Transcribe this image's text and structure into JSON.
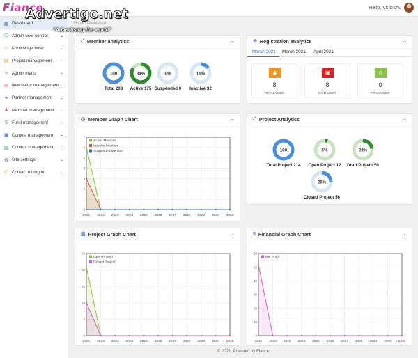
{
  "brand": {
    "logo": "Fiance",
    "watermark": "Advertigo.net",
    "watermark_tagline": "\"Advertising  the world\""
  },
  "header": {
    "collapse_icon": "chevron-left-icon",
    "user_greeting": "Hello, Vk bishu"
  },
  "breadcrumb": {
    "home": "Home",
    "sep": "/",
    "current": "Dashboard"
  },
  "sidebar": {
    "items": [
      {
        "label": "Dashboard",
        "icon": "grid-icon",
        "glyph": "▦",
        "color": "#4a7cc2",
        "expandable": false,
        "active": true
      },
      {
        "label": "Admin user control",
        "icon": "power-icon",
        "glyph": "⏻",
        "color": "#3aa76d",
        "expandable": true
      },
      {
        "label": "Knowledge base",
        "icon": "book-icon",
        "glyph": "▭",
        "color": "#e0a030",
        "expandable": true
      },
      {
        "label": "Project management",
        "icon": "document-icon",
        "glyph": "▤",
        "color": "#e0a030",
        "expandable": true
      },
      {
        "label": "Admin menu",
        "icon": "menu-icon",
        "glyph": "≡",
        "color": "#4a7cc2",
        "expandable": true
      },
      {
        "label": "Newsletter management",
        "icon": "envelope-icon",
        "glyph": "✉",
        "color": "#d9534f",
        "expandable": true
      },
      {
        "label": "Partner management",
        "icon": "handshake-icon",
        "glyph": "⚭",
        "color": "#7a5cc2",
        "expandable": true
      },
      {
        "label": "Member management",
        "icon": "user-icon",
        "glyph": "♟",
        "color": "#d9534f",
        "expandable": true
      },
      {
        "label": "Fund management",
        "icon": "dollar-icon",
        "glyph": "$",
        "color": "#3aa76d",
        "expandable": true
      },
      {
        "label": "Contest management",
        "icon": "trophy-icon",
        "glyph": "▣",
        "color": "#4a7cc2",
        "expandable": true
      },
      {
        "label": "Content management",
        "icon": "file-icon",
        "glyph": "▥",
        "color": "#3aa76d",
        "expandable": true
      },
      {
        "label": "Site settings",
        "icon": "gear-icon",
        "glyph": "⚙",
        "color": "#7a5cc2",
        "expandable": true
      },
      {
        "label": "Contact us mgmt.",
        "icon": "phone-icon",
        "glyph": "✆",
        "color": "#e0a030",
        "expandable": true
      }
    ]
  },
  "member_analytics": {
    "title": "Member analytics",
    "icon": "analytics-icon",
    "donuts": [
      {
        "value": "100",
        "label": "Total 208",
        "pct": 100,
        "color": "#4a90d9",
        "track": "#cfe0f3"
      },
      {
        "value": "84%",
        "label": "Active 175",
        "pct": 84,
        "color": "#2e8b2e",
        "track": "#c8e2c0"
      },
      {
        "value": "0%",
        "label": "Suspended 0",
        "pct": 0,
        "color": "#4a90d9",
        "track": "#d7e6f5"
      },
      {
        "value": "15%",
        "label": "Inactive 32",
        "pct": 15,
        "color": "#4a90d9",
        "track": "#d7e6f5"
      }
    ]
  },
  "registration_analytics": {
    "title": "Registration analytics",
    "icon": "circle-plus-icon",
    "tabs": [
      "March 2021",
      "March 2021",
      "April 2021"
    ],
    "stats": [
      {
        "value": "8",
        "label": "TOTAL USER",
        "icon": "user-icon",
        "glyph": "♟",
        "color": "#f5941f"
      },
      {
        "value": "8",
        "label": "PAID USER",
        "icon": "camera-icon",
        "glyph": "▣",
        "color": "#e0201f"
      },
      {
        "value": "0",
        "label": "FREE USER",
        "icon": "smile-icon",
        "glyph": "☺",
        "color": "#8bc34a"
      }
    ]
  },
  "member_graph": {
    "title": "Member Graph Chart",
    "icon": "clock-icon",
    "chart_data": {
      "type": "line",
      "x": [
        "2021",
        "2022",
        "2023",
        "2024",
        "2025",
        "2026",
        "2027",
        "2028",
        "2029",
        "2030",
        "2031"
      ],
      "ylim": [
        0,
        7
      ],
      "yticks": [
        0,
        1,
        2,
        3,
        4,
        5,
        6,
        7
      ],
      "series": [
        {
          "name": "Active Member",
          "color": "#8cc43f",
          "values": [
            6,
            0,
            0,
            0,
            0,
            0,
            0,
            0,
            0,
            0,
            0
          ]
        },
        {
          "name": "Inactive Member",
          "color": "#d9534f",
          "values": [
            3,
            0,
            0,
            0,
            0,
            0,
            0,
            0,
            0,
            0,
            0
          ]
        },
        {
          "name": "Suspended Member",
          "color": "#2f6fbe",
          "values": [
            0,
            0,
            0,
            0,
            0,
            0,
            0,
            0,
            0,
            0,
            0
          ]
        }
      ]
    }
  },
  "project_analytics": {
    "title": "Project Analytics",
    "icon": "analytics-icon",
    "donuts": [
      {
        "value": "100",
        "label": "Total Project 214",
        "pct": 100,
        "color": "#4a90d9",
        "track": "#cfe0f3"
      },
      {
        "value": "5%",
        "label": "Open Project 12",
        "pct": 5,
        "color": "#2e8b2e",
        "track": "#c8e2c0"
      },
      {
        "value": "23%",
        "label": "Draft Project 50",
        "pct": 23,
        "color": "#2e8b2e",
        "track": "#c8e2c0"
      },
      {
        "value": "26%",
        "label": "Closed Project 56",
        "pct": 26,
        "color": "#4a90d9",
        "track": "#d7e6f5"
      }
    ]
  },
  "project_graph": {
    "title": "Project Graph Chart",
    "icon": "bar-chart-icon",
    "chart_data": {
      "type": "line",
      "x": [
        "2021",
        "2022",
        "2023",
        "2024",
        "2025",
        "2026",
        "2027",
        "2028",
        "2029",
        "2030",
        "2031"
      ],
      "ylim": [
        0,
        25
      ],
      "yticks": [
        0,
        5,
        10,
        15,
        20,
        25
      ],
      "series": [
        {
          "name": "Open Project",
          "color": "#8cc43f",
          "values": [
            21,
            0,
            0,
            0,
            0,
            0,
            0,
            0,
            0,
            0,
            0
          ]
        },
        {
          "name": "Closed Project",
          "color": "#d65ec6",
          "values": [
            10,
            0,
            0,
            0,
            0,
            0,
            0,
            0,
            0,
            0,
            0
          ]
        }
      ]
    }
  },
  "financial_graph": {
    "title": "Financial Graph Chart",
    "icon": "dollar-icon",
    "chart_data": {
      "type": "line",
      "x": [
        "2021",
        "2022",
        "2023",
        "2024",
        "2025",
        "2026",
        "2027",
        "2028",
        "2029",
        "2030",
        "2031"
      ],
      "ylim": [
        0,
        60
      ],
      "yticks": [
        0,
        10,
        20,
        30,
        40,
        50,
        60
      ],
      "series": [
        {
          "name": "Net Profit",
          "color": "#d65ec6",
          "values": [
            52,
            0,
            0,
            0,
            0,
            0,
            0,
            0,
            0,
            0,
            0
          ]
        }
      ]
    }
  },
  "footer": {
    "text": "© 2021. Powered by Fiance"
  }
}
